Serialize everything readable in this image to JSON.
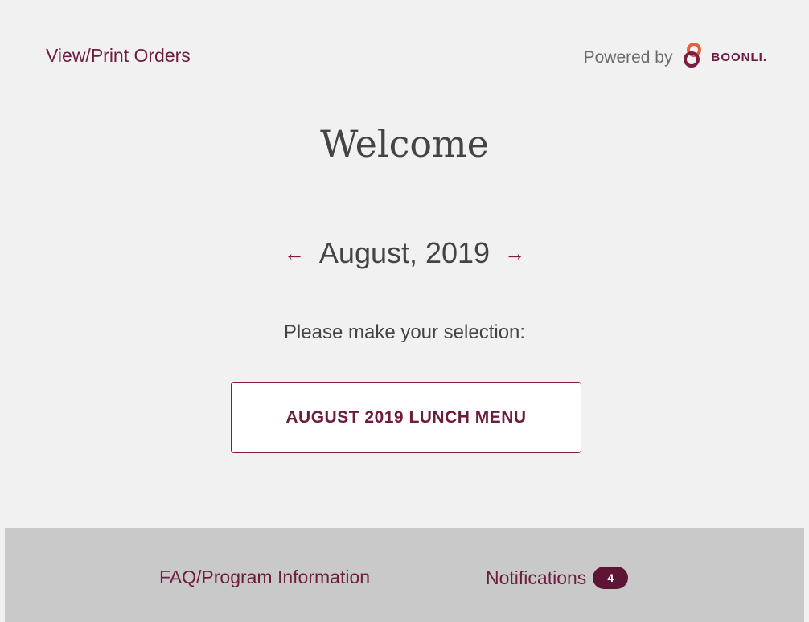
{
  "header": {
    "view_orders_label": "View/Print Orders",
    "powered_by_label": "Powered by",
    "brand_name": "BOONLI."
  },
  "main": {
    "welcome_title": "Welcome",
    "month_label": "August, 2019",
    "prev_arrow": "←",
    "next_arrow": "→",
    "prompt": "Please make your selection:",
    "menu_button_label": "AUGUST 2019 LUNCH MENU"
  },
  "footer": {
    "faq_label": "FAQ/Program Information",
    "notifications_label": "Notifications",
    "notifications_count": "4"
  },
  "colors": {
    "accent": "#8a1846",
    "brand": "#6d1b3e",
    "footer_bg": "#c9c9c9",
    "badge_bg": "#5e1535"
  },
  "icons": {
    "brand_logo": "boonli-logo-icon",
    "prev": "arrow-left-icon",
    "next": "arrow-right-icon"
  }
}
